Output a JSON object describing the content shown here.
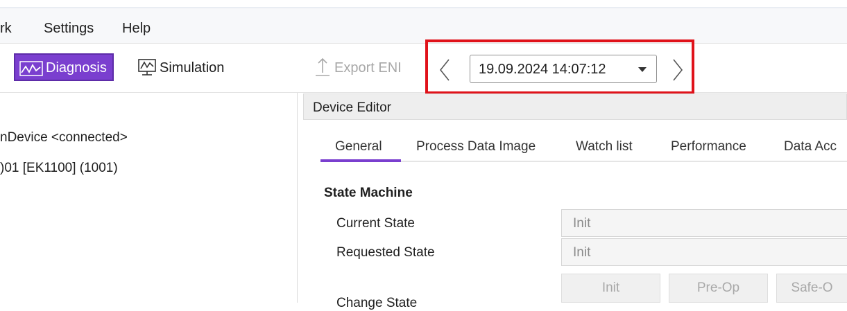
{
  "menu": {
    "items": [
      {
        "label": "rk"
      },
      {
        "label": "Settings"
      },
      {
        "label": "Help"
      }
    ]
  },
  "toolbar": {
    "diagnosis_label": "Diagnosis",
    "simulation_label": "Simulation",
    "export_label": "Export ENI",
    "date_value": "19.09.2024 14:07:12"
  },
  "tree": {
    "items": [
      {
        "label": "nDevice <connected>"
      },
      {
        "label": ")01 [EK1100] (1001)"
      }
    ]
  },
  "editor": {
    "title": "Device Editor",
    "tabs": [
      {
        "label": "General",
        "active": true
      },
      {
        "label": "Process Data Image"
      },
      {
        "label": "Watch list"
      },
      {
        "label": "Performance"
      },
      {
        "label": "Data Acc"
      }
    ],
    "state_machine": {
      "title": "State Machine",
      "current_label": "Current State",
      "current_value": "Init",
      "requested_label": "Requested State",
      "requested_value": "Init",
      "change_label": "Change State",
      "buttons": [
        {
          "label": "Init"
        },
        {
          "label": "Pre-Op"
        },
        {
          "label": "Safe-O"
        }
      ]
    }
  },
  "colors": {
    "accent": "#7a3fcf",
    "highlight": "#e0121a"
  }
}
